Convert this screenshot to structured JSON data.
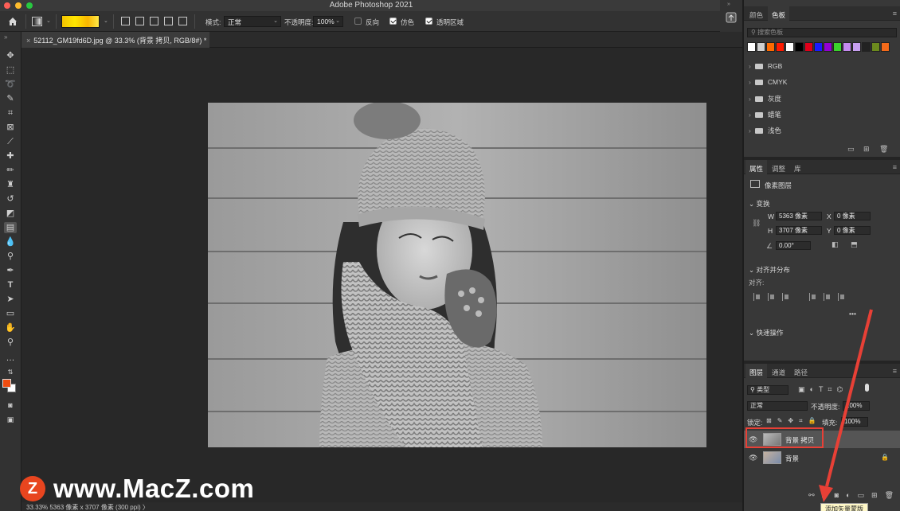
{
  "window": {
    "title": "Adobe Photoshop 2021",
    "traffic_colors": [
      "#fe5f57",
      "#febc2e",
      "#28c840"
    ]
  },
  "options_bar": {
    "mode_label": "模式:",
    "mode_value": "正常",
    "opacity_label": "不透明度:",
    "opacity_value": "100%",
    "reverse_label": "反向",
    "dither_label": "仿色",
    "transparency_label": "透明区域",
    "gradient_colors": [
      "#f5c400",
      "#ffe600"
    ]
  },
  "document": {
    "tab_title": "52112_GM19fd6D.jpg @ 33.3% (背景 拷贝, RGB/8#) *",
    "close_glyph": "×"
  },
  "tools": {
    "foreground_color": "#f04c10",
    "background_color": "#ffffff"
  },
  "status_bar": {
    "text": "33.33%   5363 像素 x 3707 像素 (300 ppi)  〉"
  },
  "watermark": {
    "logo_letter": "Z",
    "text": "www.MacZ.com"
  },
  "swatches_panel": {
    "tabs": [
      "颜色",
      "色板"
    ],
    "active_tab": "色板",
    "search_placeholder": "搜索色板",
    "swatch_colors": [
      "#ffffff",
      "#d0d0d0",
      "#ff6a00",
      "#ff1a00",
      "#ffffff",
      "#000000",
      "#e0001a",
      "#1b1bff",
      "#9400d3",
      "#3bd32b",
      "#c58af0",
      "#c8a0f0",
      "#222222",
      "#6c8a1e",
      "#f46a1a"
    ],
    "folders": [
      "RGB",
      "CMYK",
      "灰度",
      "蜡笔",
      "浅色"
    ]
  },
  "properties_panel": {
    "tabs": [
      "属性",
      "调整",
      "库"
    ],
    "active_tab": "属性",
    "layer_type": "像素图层",
    "transform_title": "变换",
    "w_label": "W",
    "w_value": "5363 像素",
    "h_label": "H",
    "h_value": "3707 像素",
    "x_label": "X",
    "x_value": "0 像素",
    "y_label": "Y",
    "y_value": "0 像素",
    "angle_value": "0.00°",
    "align_title": "对齐并分布",
    "align_label": "对齐:",
    "more_glyph": "•••",
    "quick_actions_title": "快速操作"
  },
  "layers_panel": {
    "tabs": [
      "图层",
      "通道",
      "路径"
    ],
    "active_tab": "图层",
    "filter_label": "类型",
    "blend_mode": "正常",
    "opacity_label": "不透明度:",
    "opacity_value": "100%",
    "lock_label": "锁定:",
    "fill_label": "填充:",
    "fill_value": "100%",
    "layers": [
      {
        "name": "背景 拷贝",
        "selected": true
      },
      {
        "name": "背景",
        "selected": false
      }
    ],
    "tooltip": "添加矢量蒙版"
  },
  "annotation": {
    "highlight_color": "#e84036"
  }
}
